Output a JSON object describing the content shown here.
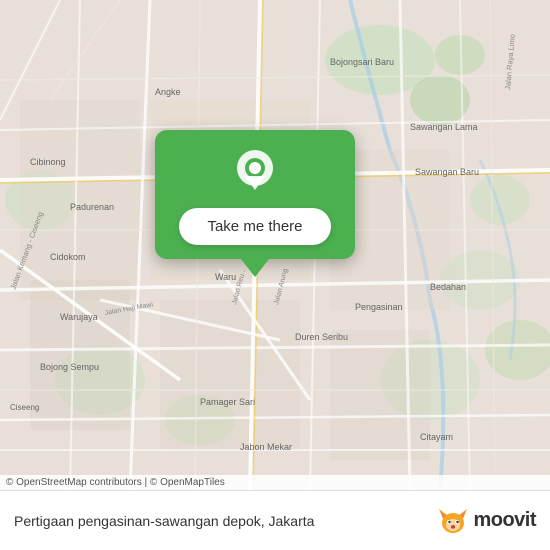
{
  "map": {
    "background_color": "#e8e0d8",
    "copyright": "© OpenStreetMap contributors | © OpenMapTiles"
  },
  "popup": {
    "button_label": "Take me there",
    "background_color": "#4caf50"
  },
  "bottom_bar": {
    "location_name": "Pertigaan pengasinan-sawangan depok, Jakarta",
    "brand": "moovit"
  },
  "labels": {
    "cibinong": "Cibinong",
    "padurenan": "Padurenan",
    "cidokom": "Cidokom",
    "warujaya": "Warujaya",
    "bojong_sempu": "Bojong Sempu",
    "ciseeng": "Ciseeng",
    "bojongsari_baru": "Bojongsari Baru",
    "sawangan_lama": "Sawangan Lama",
    "sawangan_baru": "Sawangan Baru",
    "duren_seribu": "Duren Seribu",
    "pengasinan": "Pengasinan",
    "bedahan": "Bedahan",
    "pamager_sari": "Pamager Sari",
    "jabon_mekar": "Jabon Mekar",
    "citayam": "Citayam",
    "waru": "Waru",
    "angke": "Angke",
    "jalan_kemang_ciseeng": "Jalan Kemang - Ciseeng",
    "jalan_haji_mawi": "Jalan Haji Mawi",
    "jalan_raya_limo": "Jalan Raya Limo"
  }
}
